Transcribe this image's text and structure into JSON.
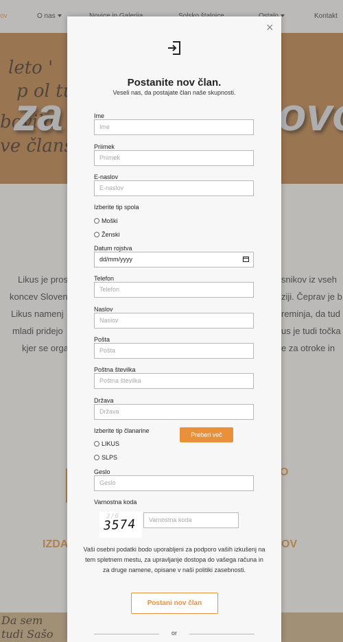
{
  "nav": {
    "item_ov": "ov",
    "item_onas": "O nas",
    "item_novice": "Novice in Galerija",
    "item_solsko": "Solsko štalojce",
    "item_ostalo": "Ostalo",
    "item_kontakt": "Kontakt"
  },
  "hero": {
    "handwriting_1": "leto '",
    "handwriting_2": "p ol tu",
    "handwriting_3": "bovila",
    "handwriting_4": "ve člans",
    "big_left": "za",
    "big_right": "ovo"
  },
  "background": {
    "line_1_left": "Likus je pros",
    "line_1_right": "snikov iz vseh",
    "line_2_left": "koncev Sloven",
    "line_2_right": "ziji. Čeprav je b",
    "line_3_left": "Likus namenj",
    "line_3_right": "reminja, da tud",
    "line_4_left": "mladi pridejo",
    "line_4_right": "us je tudi točka",
    "line_5_left": "kjer se organ",
    "line_5_right": "e za otroke in",
    "heading_left": "IZDA",
    "heading_right": "OV",
    "heading_2_right": "O",
    "footer_left": "Da sem",
    "footer_left_2": "tudi Sašo"
  },
  "modal": {
    "title": "Postanite nov član.",
    "subtitle": "Veseli nas, da postajate član naše skupnosti.",
    "fields": {
      "ime": {
        "label": "Ime",
        "placeholder": "Ime"
      },
      "priimek": {
        "label": "Priimek",
        "placeholder": "Priimek"
      },
      "email": {
        "label": "E-naslov",
        "placeholder": "E-naslov"
      },
      "spol": {
        "label": "Izberite tip spola",
        "option_1": "Moški",
        "option_2": "Ženski"
      },
      "datum": {
        "label": "Datum rojstva",
        "value": "dd/mm/yyyy"
      },
      "telefon": {
        "label": "Telefon",
        "placeholder": "Telefon"
      },
      "naslov": {
        "label": "Naslov",
        "placeholder": "Naslov"
      },
      "posta": {
        "label": "Pošta",
        "placeholder": "Pošta"
      },
      "postna_st": {
        "label": "Poštna številka",
        "placeholder": "Poštna številka"
      },
      "drzava": {
        "label": "Država",
        "placeholder": "Država"
      },
      "clanarina": {
        "label": "Izberite tip članarine",
        "option_1": "LIKUS",
        "option_2": "SLPS",
        "more_button": "Preberi več"
      },
      "geslo": {
        "label": "Geslo",
        "placeholder": "Geslo"
      },
      "varnostna": {
        "label": "Varnostna koda",
        "placeholder": "Varnostna koda",
        "captcha_code": "3574",
        "captcha_noise": "2/6"
      }
    },
    "privacy_text": "Vaši osebni podatki bodo uporabljeni za podporo vaših izkušenj na tem spletnem mestu, za upravljanje dostopa do vašega računa in za druge namene, opisane v naši politiki zasebnosti.",
    "submit_label": "Postani nov član",
    "or_label": "or",
    "close_glyph": "×",
    "accent_color": "#e8913a",
    "icons": [
      "login-icon",
      "close-icon",
      "calendar-icon"
    ]
  }
}
